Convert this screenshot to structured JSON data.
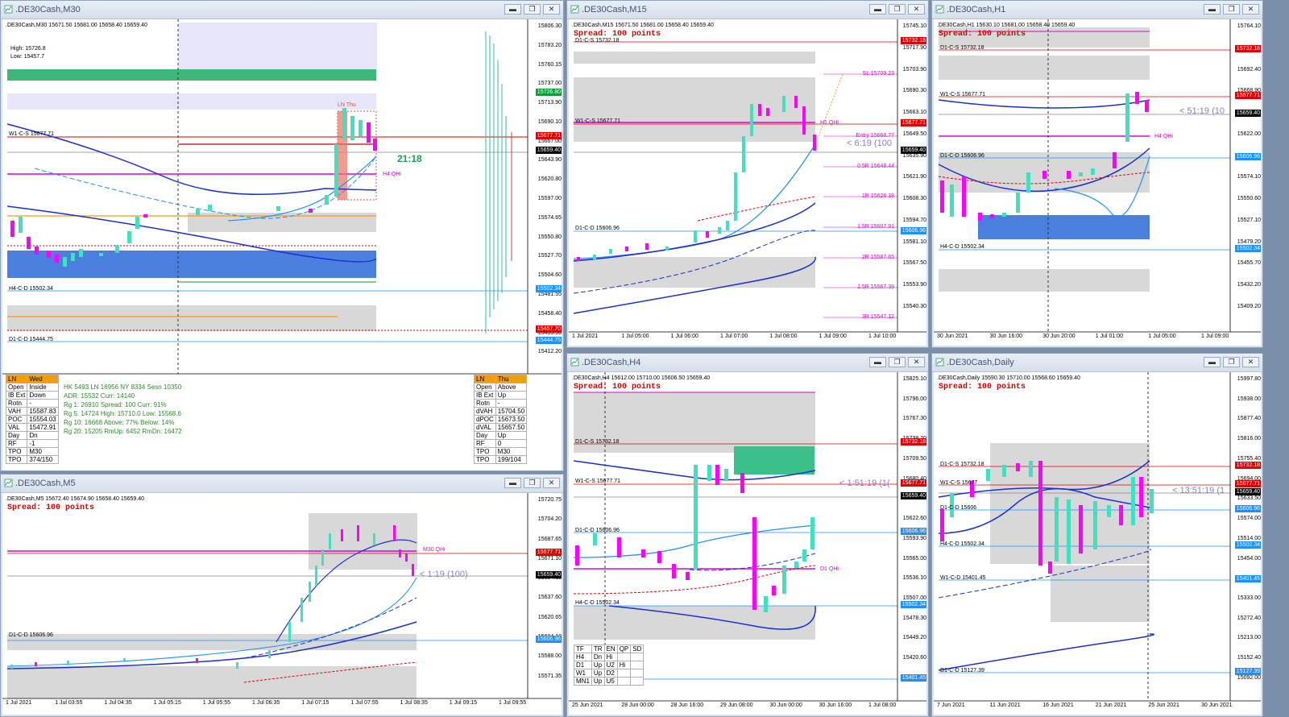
{
  "windows": {
    "m30": {
      "title": ".DE30Cash,M30",
      "header": ".DE30Cash,M30  15671.50 15681.00 15658.40 15659.40",
      "high_label": "High: 15726.8",
      "low_label": "Low: 15457.7",
      "w1_label": "W1-C-S 15677.71",
      "h4_label": "H4-C-D 15502.34",
      "d1_label": "D1-C-D 15444.75",
      "h4qhi": "H4 QHi",
      "ln_thu": "LN Thu",
      "countdown": "21:18",
      "prices": [
        "15806.30",
        "15783.20",
        "15760.15",
        "15737.00",
        "15713.90",
        "15690.10",
        "15667.00",
        "15643.90",
        "15620.80",
        "15597.00",
        "15574.65",
        "15550.80",
        "15527.70",
        "15504.60",
        "15481.55",
        "15458.40",
        "15435.30",
        "15412.20"
      ],
      "price_boxes": [
        {
          "label": "15726.80",
          "color": "#129b38"
        },
        {
          "label": "15677.71",
          "color": "#e00000"
        },
        {
          "label": "15659.40",
          "color": "#000000"
        },
        {
          "label": "15502.34",
          "color": "#1e90ff"
        },
        {
          "label": "15457.70",
          "color": "#e00000"
        },
        {
          "label": "15444.75",
          "color": "#1e90ff"
        }
      ],
      "left_table": [
        [
          "LN",
          "Wed"
        ],
        [
          "Open",
          "Inside"
        ],
        [
          "IB Ext",
          "Down"
        ],
        [
          "Rotn",
          "-"
        ],
        [
          "VAH",
          "15587.83"
        ],
        [
          "POC",
          "15554.03"
        ],
        [
          "VAL",
          "15472.91"
        ],
        [
          "Day",
          "Dn"
        ],
        [
          "RF",
          "-1"
        ],
        [
          "TPO",
          "M30"
        ],
        [
          "TPO",
          "374/150"
        ]
      ],
      "mid_lines": [
        "HK 5493  LN 16956  NY 8334  Sesn 10350",
        "ADR: 15532  Curr: 14140",
        "Rg 1: 26910  Spread: 100  Curr: 91%",
        "Rg 5: 14724  High: 15710.0  Low: 15568.6",
        "Rg 10: 16668  Above: 77%  Below: 14%",
        "Rg 20: 15205  RmUp: 6452  RmDn: 16472"
      ],
      "right_table": [
        [
          "LN",
          "Thu"
        ],
        [
          "Open",
          "Above"
        ],
        [
          "IB Ext",
          "Up"
        ],
        [
          "Rotn",
          "-"
        ],
        [
          "dVAH",
          "15704.50"
        ],
        [
          "dPOC",
          "15673.50"
        ],
        [
          "dVAL",
          "15657.50"
        ],
        [
          "Day",
          "Up"
        ],
        [
          "RF",
          "0"
        ],
        [
          "TPO",
          "M30"
        ],
        [
          "TPO",
          "199/104"
        ]
      ]
    },
    "m15": {
      "title": ".DE30Cash,M15",
      "header": ".DE30Cash,M15  15671.50 15681.00 15658.40 15659.40",
      "spread": "Spread: 100 points",
      "d1cs": "D1-C-S 15732.18",
      "w1cs": "W1-C-S 15677.71",
      "d1cd": "D1-C-D 15606.96",
      "h1qhi": "H1 QHi",
      "countdown": "< 6:19 (100",
      "levels": [
        "SL 15709.23",
        "Entry 15668.77",
        "0.5R 15648.44",
        "1R 15628.18",
        "1.5R 15607.91",
        "2R 15587.65",
        "2.5R 15567.39",
        "3R 15547.12"
      ],
      "prices": [
        "15745.10",
        "15717.90",
        "15703.90",
        "15690.30",
        "15663.10",
        "15649.50",
        "15635.90",
        "15621.90",
        "15608.30",
        "15594.70",
        "15581.10",
        "15567.50",
        "15553.90",
        "15540.30"
      ],
      "price_boxes": [
        {
          "label": "15732.18",
          "color": "#e00000"
        },
        {
          "label": "15677.71",
          "color": "#e00000"
        },
        {
          "label": "15659.40",
          "color": "#000000"
        },
        {
          "label": "15606.96",
          "color": "#1e90ff"
        }
      ],
      "times": [
        "1 Jul 2021",
        "1 Jul 05:00",
        "1 Jul 06:00",
        "1 Jul 07:00",
        "1 Jul 08:00",
        "1 Jul 09:00",
        "1 Jul 10:00"
      ]
    },
    "h1": {
      "title": ".DE30Cash,H1",
      "header": ".DE30Cash,H1  15630.10 15681.00 15658.40 15659.40",
      "spread": "Spread: 100 points",
      "d1cs": "D1-C-S 15732.18",
      "w1cs": "W1-C-S 15677.71",
      "d1cd": "D1-C-D 15606.96",
      "h4cd": "H4-C-D 15502.34",
      "h4qhi": "H4 QHi",
      "countdown": "< 51:19 (10",
      "prices": [
        "15764.10",
        "15718.40",
        "15692.40",
        "15668.90",
        "15645.40",
        "15622.00",
        "15598.50",
        "15574.10",
        "15550.60",
        "15527.10",
        "15479.20",
        "15455.70",
        "15432.20",
        "15409.20"
      ],
      "price_boxes": [
        {
          "label": "15732.18",
          "color": "#e00000"
        },
        {
          "label": "15677.71",
          "color": "#e00000"
        },
        {
          "label": "15659.40",
          "color": "#000000"
        },
        {
          "label": "15606.96",
          "color": "#1e90ff"
        },
        {
          "label": "15502.34",
          "color": "#1e90ff"
        }
      ],
      "times": [
        "30 Jun 2021",
        "30 Jun 16:00",
        "30 Jun 20:00",
        "1 Jul 01:00",
        "1 Jul 05:00",
        "1 Jul 09:00"
      ]
    },
    "m5": {
      "title": ".DE30Cash,M5",
      "header": ".DE30Cash,M5  15672.40 15674.90 15658.40 15659.40",
      "spread": "Spread: 100 points",
      "w1cs": "W1-C-S 15677.71",
      "d1cd": "D1-C-D 15606.96",
      "m30qhi": "M30 QHi",
      "countdown": "< 1:19 (100)",
      "prices": [
        "15720.75",
        "15704.20",
        "15687.65",
        "15671.10",
        "15654.15",
        "15637.60",
        "15620.65",
        "15604.10",
        "15588.00",
        "15571.35"
      ],
      "price_boxes": [
        {
          "label": "15677.71",
          "color": "#e00000"
        },
        {
          "label": "15659.40",
          "color": "#000000"
        },
        {
          "label": "15606.96",
          "color": "#1e90ff"
        }
      ],
      "times": [
        "1 Jul 2021",
        "1 Jul 03:55",
        "1 Jul 04:35",
        "1 Jul 05:15",
        "1 Jul 05:55",
        "1 Jul 06:35",
        "1 Jul 07:15",
        "1 Jul 07:55",
        "1 Jul 08:35",
        "1 Jul 09:15",
        "1 Jul 09:55"
      ]
    },
    "h4": {
      "title": ".DE30Cash,H4",
      "header": ".DE30Cash,H4  15612.00 15710.00 15606.50 15659.40",
      "spread": "Spread: 100 points",
      "d1cs": "D1-C-S 15732.18",
      "w1cs": "W1-C-S 15677.71",
      "d1cd": "D1-C-D 15606.96",
      "h4cd": "H4-C-D 15502.34",
      "d1qhi": "D1 QHi",
      "countdown": "< 1:51:19 (1(",
      "prices": [
        "15825.10",
        "15796.00",
        "15767.30",
        "15738.20",
        "15709.50",
        "15680.40",
        "15651.70",
        "15622.60",
        "15593.90",
        "15565.00",
        "15536.10",
        "15507.00",
        "15478.30",
        "15449.20",
        "15420.60",
        "15392.00"
      ],
      "price_boxes": [
        {
          "label": "15732.18",
          "color": "#e00000"
        },
        {
          "label": "15677.71",
          "color": "#e00000"
        },
        {
          "label": "15659.40",
          "color": "#000000"
        },
        {
          "label": "15606.96",
          "color": "#1e90ff"
        },
        {
          "label": "15502.34",
          "color": "#1e90ff"
        },
        {
          "label": "15401.45",
          "color": "#1e90ff"
        }
      ],
      "times": [
        "25 Jun 2021",
        "28 Jun 00:00",
        "28 Jun 16:00",
        "29 Jun 08:00",
        "30 Jun 00:00",
        "30 Jun 16:00",
        "1 Jul 08:00"
      ],
      "trend_table": [
        [
          "TF",
          "TR",
          "EN",
          "QP",
          "SD"
        ],
        [
          "H4",
          "Dn",
          "Hi",
          "",
          ""
        ],
        [
          "D1",
          "Up",
          "U2",
          "Hi",
          ""
        ],
        [
          "W1",
          "Up",
          "D2",
          "",
          ""
        ],
        [
          "MN1",
          "Up",
          "U5",
          "",
          ""
        ]
      ]
    },
    "daily": {
      "title": ".DE30Cash,Daily",
      "header": ".DE30Cash,Daily  15590.30 15710.00 15568.60 15659.40",
      "spread": "Spread: 100 points",
      "d1cs": "D1-C-S 15732.18",
      "w1cs": "W1-C-S 15677",
      "d1cd": "D1-C-D 15606",
      "h4cd": "H4-C-D 15502.34",
      "w1cd": "W1-C-D 15401.45",
      "d1cd2": "D1-C-D 15127.39",
      "countdown": "< 13:51:19 (1",
      "prices": [
        "15997.80",
        "15938.00",
        "15877.40",
        "15816.00",
        "15755.40",
        "15694.00",
        "15633.50",
        "15574.00",
        "15514.00",
        "15454.00",
        "15393.70",
        "15333.00",
        "15272.40",
        "15213.00",
        "15152.40",
        "15092.00"
      ],
      "price_boxes": [
        {
          "label": "15732.18",
          "color": "#e00000"
        },
        {
          "label": "15677.71",
          "color": "#e00000"
        },
        {
          "label": "15659.40",
          "color": "#000000"
        },
        {
          "label": "15606.96",
          "color": "#1e90ff"
        },
        {
          "label": "15502.34",
          "color": "#1e90ff"
        },
        {
          "label": "15401.45",
          "color": "#1e90ff"
        },
        {
          "label": "15127.39",
          "color": "#1e90ff"
        }
      ],
      "times": [
        "7 Jun 2021",
        "11 Jun 2021",
        "16 Jun 2021",
        "21 Jun 2021",
        "25 Jun 2021",
        "30 Jun 2021"
      ]
    }
  },
  "colors": {
    "bull": "#40e0c0",
    "bear": "#ff00ff",
    "ma": "#1a30d0",
    "ma_light": "#1e90ff",
    "zone": "#d8d8d8",
    "demand": "#4a7fe0",
    "supply": "#3cc08a"
  }
}
